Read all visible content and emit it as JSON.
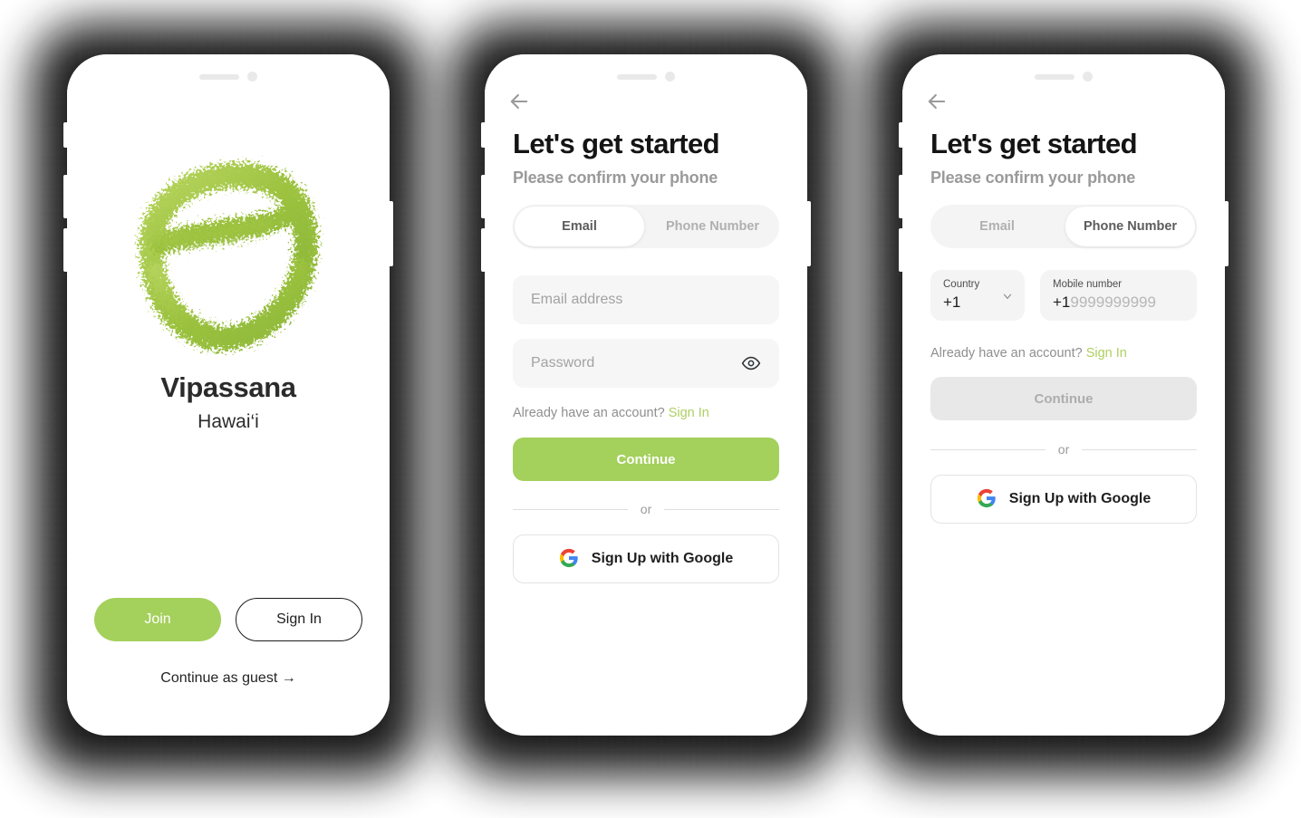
{
  "colors": {
    "brand_green": "#A4D05C",
    "link_green": "#AECF62",
    "field_bg": "#F4F4F4",
    "disabled_bg": "#E8E8E8",
    "text_dark": "#141414",
    "text_muted": "#9A9A9A"
  },
  "screens": [
    {
      "id": "welcome",
      "logo_alt": "vipassana-leaf-logo",
      "brand": "Vipassana",
      "location": "Hawai‘i",
      "join_label": "Join",
      "signin_label": "Sign In",
      "guest_label": "Continue as guest",
      "guest_arrow": "→"
    },
    {
      "id": "signup-email",
      "back_icon": "arrow-left-icon",
      "title": "Let's get started",
      "subtitle": "Please confirm your phone",
      "tabs": [
        {
          "label": "Email",
          "active": true
        },
        {
          "label": "Phone Number",
          "active": false
        }
      ],
      "email_placeholder": "Email address",
      "password_placeholder": "Password",
      "password_toggle_icon": "eye-icon",
      "have_account_text": "Already have an account?",
      "have_account_link": "Sign In",
      "continue_label": "Continue",
      "continue_disabled": false,
      "divider_label": "or",
      "google_label": "Sign Up with Google",
      "google_icon": "google-g-icon"
    },
    {
      "id": "signup-phone",
      "back_icon": "arrow-left-icon",
      "title": "Let's get started",
      "subtitle": "Please confirm your phone",
      "tabs": [
        {
          "label": "Email",
          "active": false
        },
        {
          "label": "Phone Number",
          "active": true
        }
      ],
      "country_label": "Country",
      "country_value": "+1",
      "country_chevron_icon": "chevron-down-icon",
      "mobile_label": "Mobile number",
      "mobile_prefix": "+1",
      "mobile_placeholder": "9999999999",
      "have_account_text": "Already have an account?",
      "have_account_link": "Sign In",
      "continue_label": "Continue",
      "continue_disabled": true,
      "divider_label": "or",
      "google_label": "Sign Up with Google",
      "google_icon": "google-g-icon"
    }
  ]
}
